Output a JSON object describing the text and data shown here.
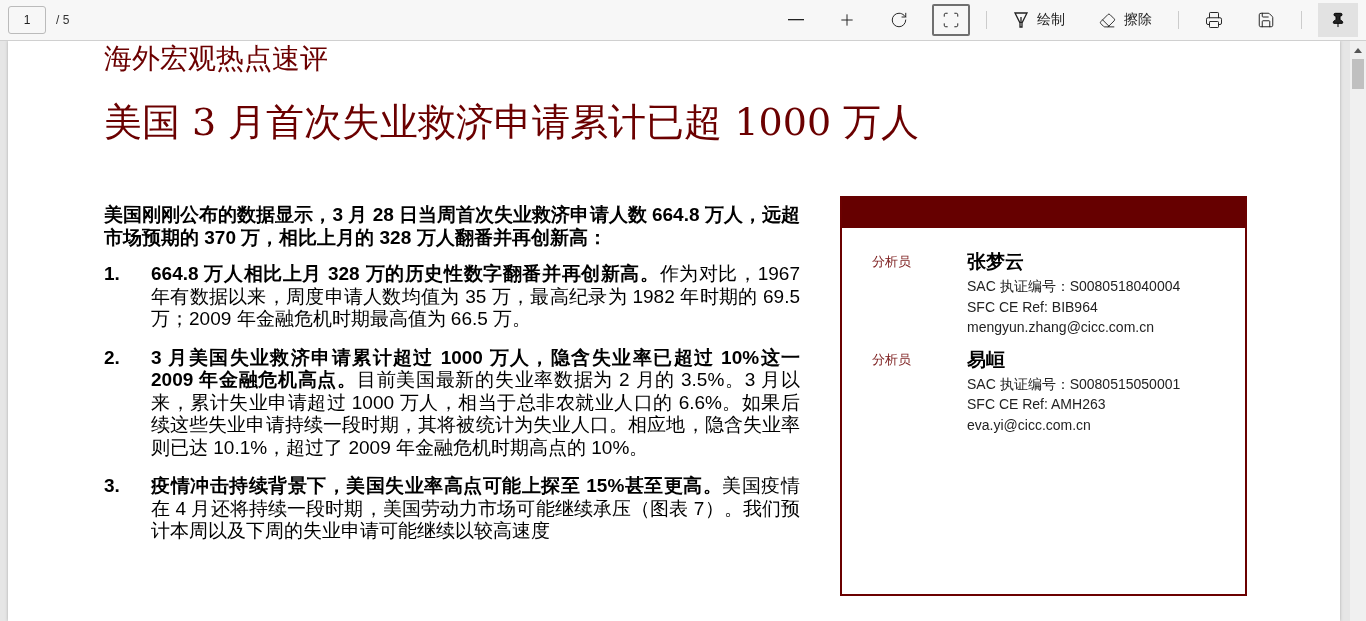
{
  "toolbar": {
    "page_number": "1",
    "page_total": "/ 5",
    "tools": [
      {
        "kind": "zoom-out",
        "selected": false
      },
      {
        "kind": "zoom-in",
        "selected": false
      },
      {
        "kind": "rotate",
        "selected": false
      },
      {
        "kind": "fit",
        "selected": true
      },
      {
        "kind": "draw",
        "label": "绘制",
        "selected": false
      },
      {
        "kind": "erase",
        "label": "擦除",
        "selected": false
      },
      {
        "kind": "print",
        "selected": false
      },
      {
        "kind": "save",
        "selected": false
      }
    ],
    "pin": {
      "on": true
    }
  },
  "document": {
    "series": "海外宏观热点速评",
    "title": "美国 3 月首次失业救济申请累计已超 1000 万人",
    "lead": "美国刚刚公布的数据显示，3 月 28 日当周首次失业救济申请人数 664.8 万人，远超市场预期的 370 万，相比上月的 328 万人翻番并再创新高：",
    "points": [
      {
        "number": "1.",
        "text": "**664.8 万人相比上月 328 万的历史性数字翻番并再创新高。**作为对比，1967 年有数据以来，周度申请人数均值为 35 万，最高纪录为 1982 年时期的 69.5 万；2009 年金融危机时期最高值为 66.5 万。"
      },
      {
        "number": "2.",
        "text": "**3 月美国失业救济申请累计超过 1000 万人，隐含失业率已超过 10%这一 2009 年金融危机高点。**目前美国最新的失业率数据为 2 月的 3.5%。3 月以来，累计失业申请超过 1000 万人，相当于总非农就业人口的 6.6%。如果后续这些失业申请持续一段时期，其将被统计为失业人口。相应地，隐含失业率则已达 10.1%，超过了 2009 年金融危机时期高点的 10%。"
      },
      {
        "number": "3.",
        "text": "**疫情冲击持续背景下，美国失业率高点可能上探至 15%甚至更高。**美国疫情在 4 月还将持续一段时期，美国劳动力市场可能继续承压（图表 7）。我们预计本周以及下周的失业申请可能继续以较高速度"
      }
    ],
    "analysts": [
      {
        "role": "分析员",
        "name": "张梦云",
        "license": "SAC  执证编号：S0080518040004",
        "ref": "SFC CE Ref:   BIB964",
        "email": "mengyun.zhang@cicc.com.cn"
      },
      {
        "role": "分析员",
        "name": "易峘",
        "license": "SAC  执证编号：S0080515050001",
        "ref": "SFC CE Ref:   AMH263",
        "email": "eva.yi@cicc.com.cn"
      }
    ]
  }
}
